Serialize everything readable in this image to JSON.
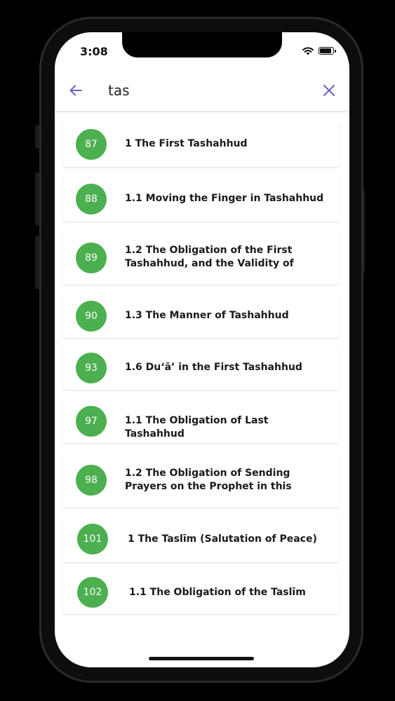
{
  "status": {
    "time": "3:08"
  },
  "search": {
    "query": "tas",
    "placeholder": ""
  },
  "colors": {
    "accent": "#6b5fc7",
    "badge": "#4caf50"
  },
  "results": [
    {
      "number": "87",
      "title": "1 The First Tashahhud"
    },
    {
      "number": "88",
      "title": "1.1 Moving the Finger in Tashahhud"
    },
    {
      "number": "89",
      "title": "1.2 The Obligation of the First Tashahhud, and the Validity of"
    },
    {
      "number": "90",
      "title": "1.3 The Manner of Tashahhud"
    },
    {
      "number": "93",
      "title": "1.6 Du‘ā’ in the First Tashahhud"
    },
    {
      "number": "97",
      "title": "1.1 The Obligation of Last Tashahhud"
    },
    {
      "number": "98",
      "title": "1.2 The Obligation of Sending Prayers on the Prophet in this"
    },
    {
      "number": "101",
      "title": "1 The Taslīm (Salutation of Peace)"
    },
    {
      "number": "102",
      "title": "1.1 The Obligation of the Taslīm"
    }
  ]
}
